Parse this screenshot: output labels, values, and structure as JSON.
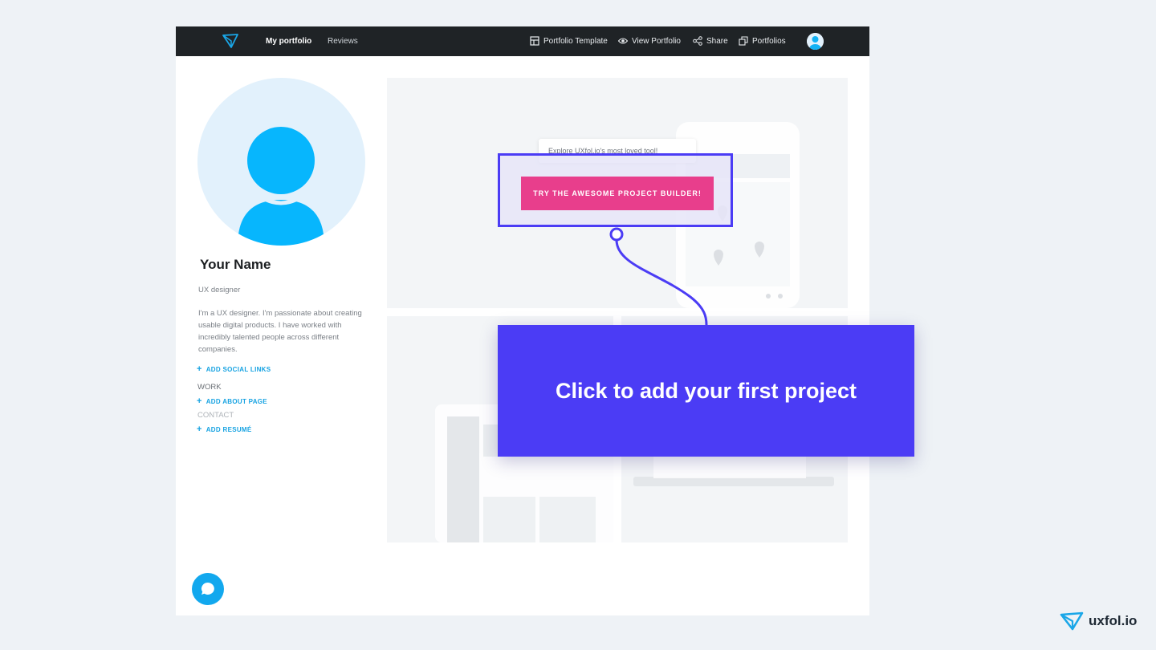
{
  "nav": {
    "my_portfolio": "My portfolio",
    "reviews": "Reviews",
    "portfolio_template": "Portfolio Template",
    "view_portfolio": "View Portfolio",
    "share": "Share",
    "portfolios": "Portfolios"
  },
  "profile": {
    "name": "Your Name",
    "role": "UX designer",
    "bio": "I'm a UX designer. I'm passionate about creating usable digital products. I have worked with incredibly talented people across different companies.",
    "add_social_links": "ADD SOCIAL LINKS",
    "work": "WORK",
    "add_about_page": "ADD ABOUT PAGE",
    "contact": "CONTACT",
    "add_resume": "ADD RESUMÉ"
  },
  "overlay": {
    "hint": "Explore UXfol.io's most loved tool!",
    "try_button": "TRY THE AWESOME PROJECT BUILDER!",
    "cta": "Click to add your first project"
  },
  "brand": {
    "name": "uxfol.io"
  },
  "colors": {
    "accent": "#4b3cf5",
    "pink": "#e83e8c",
    "link_blue": "#17a3e2",
    "nav_bg": "#1f2326"
  },
  "icons": [
    "logo-icon",
    "layout-icon",
    "eye-icon",
    "share-icon",
    "copy-icon",
    "user-avatar-icon",
    "chat-icon"
  ]
}
